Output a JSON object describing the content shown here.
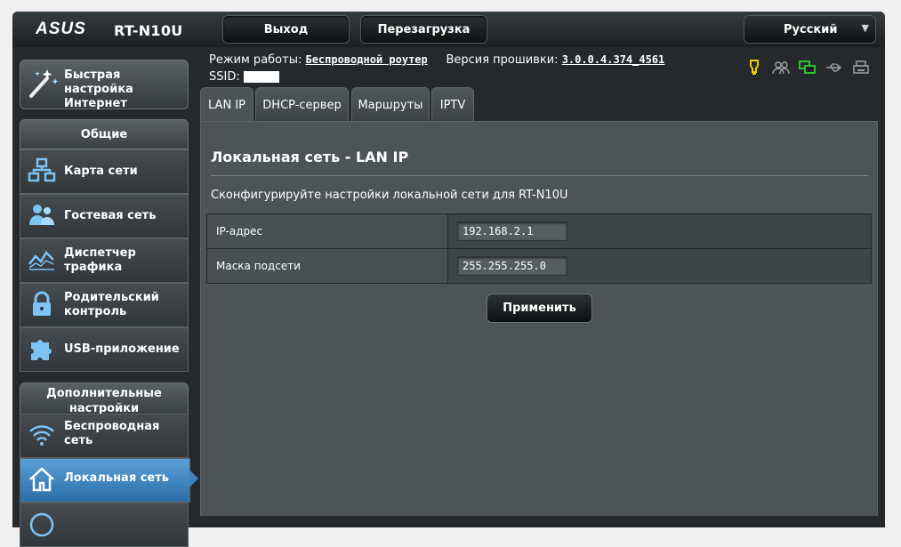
{
  "header": {
    "brand": "ASUS",
    "model": "RT-N10U",
    "logout_label": "Выход",
    "reboot_label": "Перезагрузка",
    "language": "Русский"
  },
  "info": {
    "mode_label": "Режим работы:",
    "mode_value": "Беспроводной роутер",
    "firmware_label": "Версия прошивки:",
    "firmware_value": "3.0.0.4.374_4561",
    "ssid_label": "SSID:"
  },
  "status_icons": [
    "internet-status-icon",
    "users-icon",
    "network-status-icon",
    "usb-icon",
    "printer-icon"
  ],
  "menu": {
    "quick_setup": "Быстрая настройка Интернет",
    "general_header": "Общие",
    "general_items": [
      "Карта сети",
      "Гостевая сеть",
      "Диспетчер трафика",
      "Родительский контроль",
      "USB-приложение"
    ],
    "advanced_header": "Дополнительные настройки",
    "advanced_items": [
      "Беспроводная сеть",
      "Локальная сеть"
    ]
  },
  "tabs": [
    "LAN IP",
    "DHCP-сервер",
    "Маршруты",
    "IPTV"
  ],
  "content": {
    "title": "Локальная сеть - LAN IP",
    "description": "Сконфигурируйте настройки локальной сети для RT-N10U",
    "fields": [
      {
        "label": "IP-адрес",
        "value": "192.168.2.1"
      },
      {
        "label": "Маска подсети",
        "value": "255.255.255.0"
      }
    ],
    "apply_label": "Применить"
  },
  "colors": {
    "accent_active": "#3c82c0",
    "status_yellow": "#e8d000",
    "status_green": "#2fd12f",
    "background": "#25292c"
  }
}
